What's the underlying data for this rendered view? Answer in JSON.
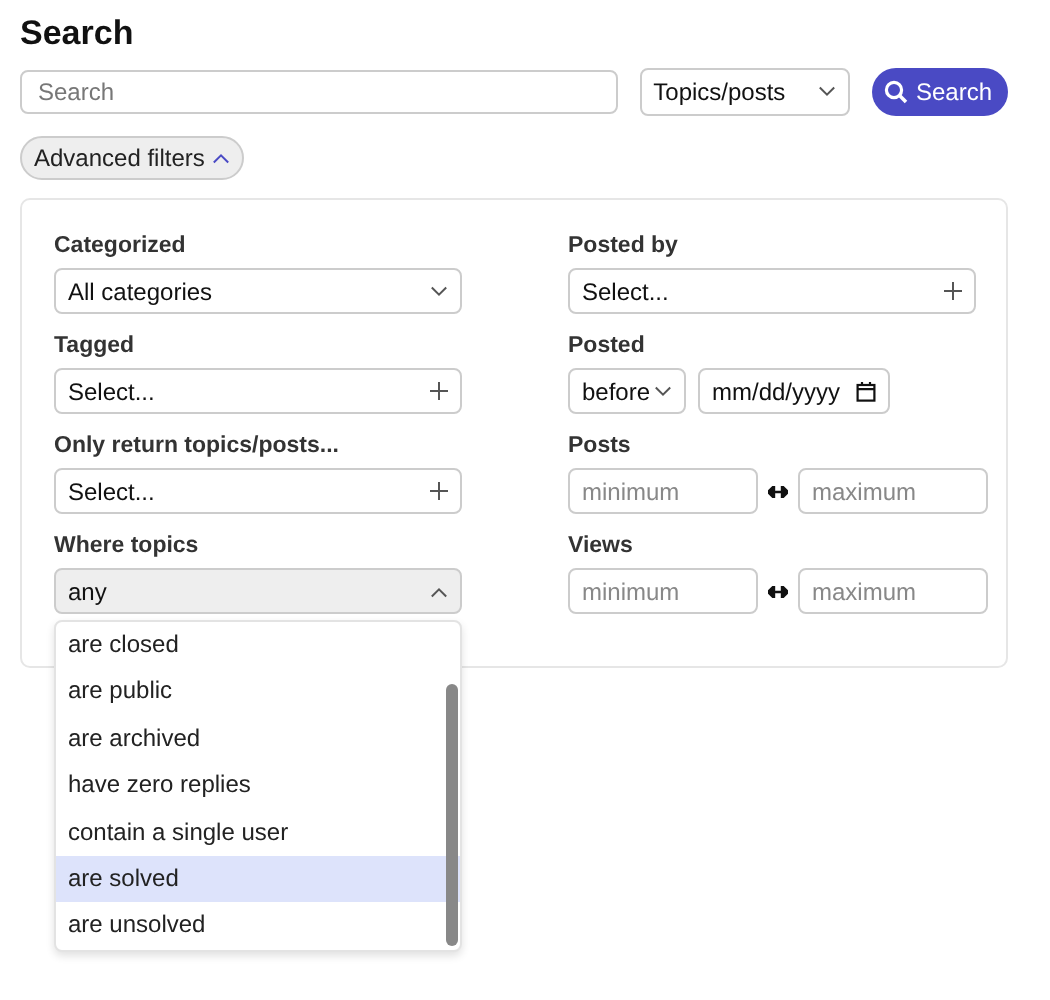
{
  "title": "Search",
  "search": {
    "placeholder": "Search"
  },
  "type_select": {
    "value": "Topics/posts"
  },
  "search_button": {
    "label": "Search"
  },
  "advanced_toggle": {
    "label": "Advanced filters",
    "expanded": true
  },
  "filters": {
    "left": [
      {
        "label": "Categorized",
        "kind": "dropdown",
        "value": "All categories",
        "expanded": false
      },
      {
        "label": "Tagged",
        "kind": "multi",
        "value": "Select..."
      },
      {
        "label": "Only return topics/posts...",
        "kind": "multi",
        "value": "Select..."
      },
      {
        "label": "Where topics",
        "kind": "dropdown",
        "value": "any",
        "expanded": true,
        "options": [
          {
            "label": "are closed",
            "selected": false
          },
          {
            "label": "are public",
            "selected": false
          },
          {
            "label": "are archived",
            "selected": false
          },
          {
            "label": "have zero replies",
            "selected": false
          },
          {
            "label": "contain a single user",
            "selected": false
          },
          {
            "label": "are solved",
            "selected": true
          },
          {
            "label": "are unsolved",
            "selected": false
          }
        ]
      }
    ],
    "right": [
      {
        "label": "Posted by",
        "kind": "multi",
        "value": "Select..."
      },
      {
        "label": "Posted",
        "kind": "date",
        "value": "before",
        "placeholder": "mm/dd/yyyy"
      },
      {
        "label": "Posts",
        "kind": "range",
        "min_placeholder": "minimum",
        "max_placeholder": "maximum"
      },
      {
        "label": "Views",
        "kind": "range",
        "min_placeholder": "minimum",
        "max_placeholder": "maximum"
      }
    ]
  }
}
